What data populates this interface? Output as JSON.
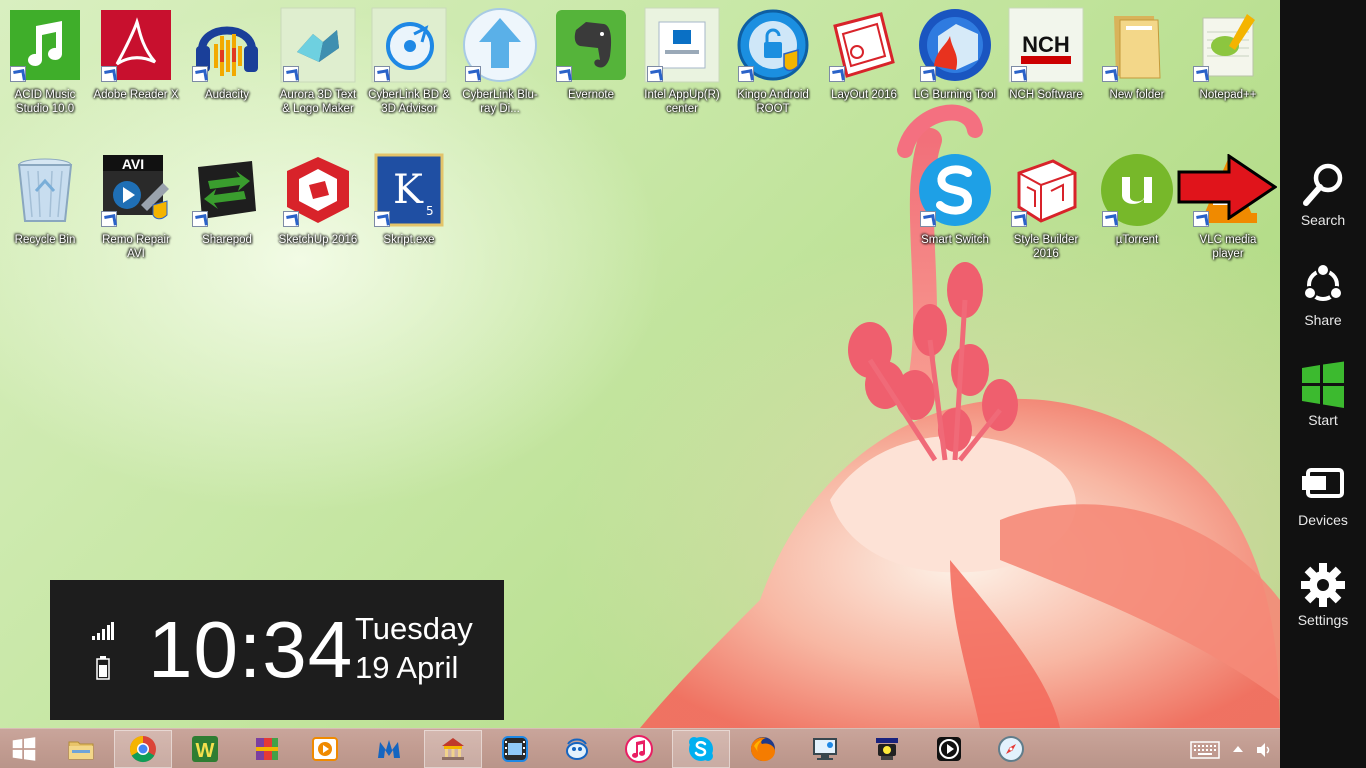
{
  "desktop": {
    "icons_row1": [
      {
        "label": "ACID Music Studio 10.0",
        "icon": "music-note-icon",
        "color": "#3fae2a"
      },
      {
        "label": "Adobe Reader X",
        "icon": "adobe-reader-icon",
        "color": "#c8102e"
      },
      {
        "label": "Audacity",
        "icon": "audacity-icon",
        "color": "#f2a900"
      },
      {
        "label": "Aurora 3D Text & Logo Maker",
        "icon": "aurora-3d-icon",
        "color": "#3a6ea8"
      },
      {
        "label": "CyberLink BD & 3D Advisor",
        "icon": "cyberlink-advisor-icon",
        "color": "#1e88e5"
      },
      {
        "label": "CyberLink Blu-ray Di...",
        "icon": "upload-arrow-icon",
        "color": "#5ab0e8"
      },
      {
        "label": "Evernote",
        "icon": "evernote-icon",
        "color": "#55b43a"
      },
      {
        "label": "Intel AppUp(R) center",
        "icon": "intel-appup-icon",
        "color": "#0a70c5"
      },
      {
        "label": "Kingo Android ROOT",
        "icon": "kingo-root-icon",
        "color": "#1b8fe0"
      },
      {
        "label": "LayOut 2016",
        "icon": "layout-icon",
        "color": "#d8232a"
      },
      {
        "label": "LG Burning Tool",
        "icon": "lg-burning-icon",
        "color": "#1a55c0"
      },
      {
        "label": "NCH Software",
        "icon": "nch-icon",
        "color": "#cc0000"
      },
      {
        "label": "New folder",
        "icon": "folder-icon",
        "color": "#e8c46a"
      },
      {
        "label": "Notepad++",
        "icon": "notepad-plus-icon",
        "color": "#8cc63f"
      }
    ],
    "icons_row2": [
      {
        "label": "Recycle Bin",
        "icon": "recycle-bin-icon",
        "color": "#7aaed8"
      },
      {
        "label": "Remo Repair AVI",
        "icon": "remo-repair-icon",
        "color": "#1f6fb5"
      },
      {
        "label": "Sharepod",
        "icon": "sharepod-icon",
        "color": "#3a9d2e"
      },
      {
        "label": "SketchUp 2016",
        "icon": "sketchup-icon",
        "color": "#d8232a"
      },
      {
        "label": "Skript.exe",
        "icon": "skript-icon",
        "color": "#1f4fa3"
      }
    ],
    "icons_row2_right": [
      {
        "label": "Smart Switch",
        "icon": "smart-switch-icon",
        "color": "#1ea0e6"
      },
      {
        "label": "Style Builder 2016",
        "icon": "style-builder-icon",
        "color": "#d8232a"
      },
      {
        "label": "µTorrent",
        "icon": "utorrent-icon",
        "color": "#77b82a"
      },
      {
        "label": "VLC media player",
        "icon": "vlc-icon",
        "color": "#f08a00"
      }
    ]
  },
  "clock": {
    "time": "10:34",
    "day": "Tuesday",
    "date": "19 April"
  },
  "charms": [
    {
      "label": "Search",
      "icon": "search-icon"
    },
    {
      "label": "Share",
      "icon": "share-icon"
    },
    {
      "label": "Start",
      "icon": "windows-logo-icon"
    },
    {
      "label": "Devices",
      "icon": "devices-icon"
    },
    {
      "label": "Settings",
      "icon": "gear-icon"
    }
  ],
  "taskbar": {
    "apps": [
      {
        "name": "file-explorer",
        "icon": "folder-icon",
        "active": false
      },
      {
        "name": "chrome",
        "icon": "chrome-icon",
        "active": true
      },
      {
        "name": "wordweb",
        "icon": "w-letter-icon",
        "active": false
      },
      {
        "name": "winrar",
        "icon": "archive-icon",
        "active": false
      },
      {
        "name": "media-player",
        "icon": "play-window-icon",
        "active": false
      },
      {
        "name": "malwarebytes",
        "icon": "malwarebytes-icon",
        "active": false
      },
      {
        "name": "temple-app",
        "icon": "temple-icon",
        "active": true
      },
      {
        "name": "video-editor",
        "icon": "film-icon",
        "active": false
      },
      {
        "name": "chat-app",
        "icon": "bird-icon",
        "active": false
      },
      {
        "name": "itunes",
        "icon": "music-note-icon",
        "active": false
      },
      {
        "name": "skype",
        "icon": "skype-icon",
        "active": true
      },
      {
        "name": "firefox",
        "icon": "firefox-icon",
        "active": false
      },
      {
        "name": "remote-desktop",
        "icon": "monitor-icon",
        "active": false
      },
      {
        "name": "hypercam",
        "icon": "camera-icon",
        "active": false
      },
      {
        "name": "media-player-2",
        "icon": "play-circle-icon",
        "active": false
      },
      {
        "name": "safari",
        "icon": "compass-icon",
        "active": false
      }
    ]
  },
  "colors": {
    "charms_bg": "#111111",
    "taskbar_bg": "#c29c91",
    "clock_bg": "#1d1d1d",
    "arrow": "#e0141b",
    "start_green": "#3cba2f"
  }
}
